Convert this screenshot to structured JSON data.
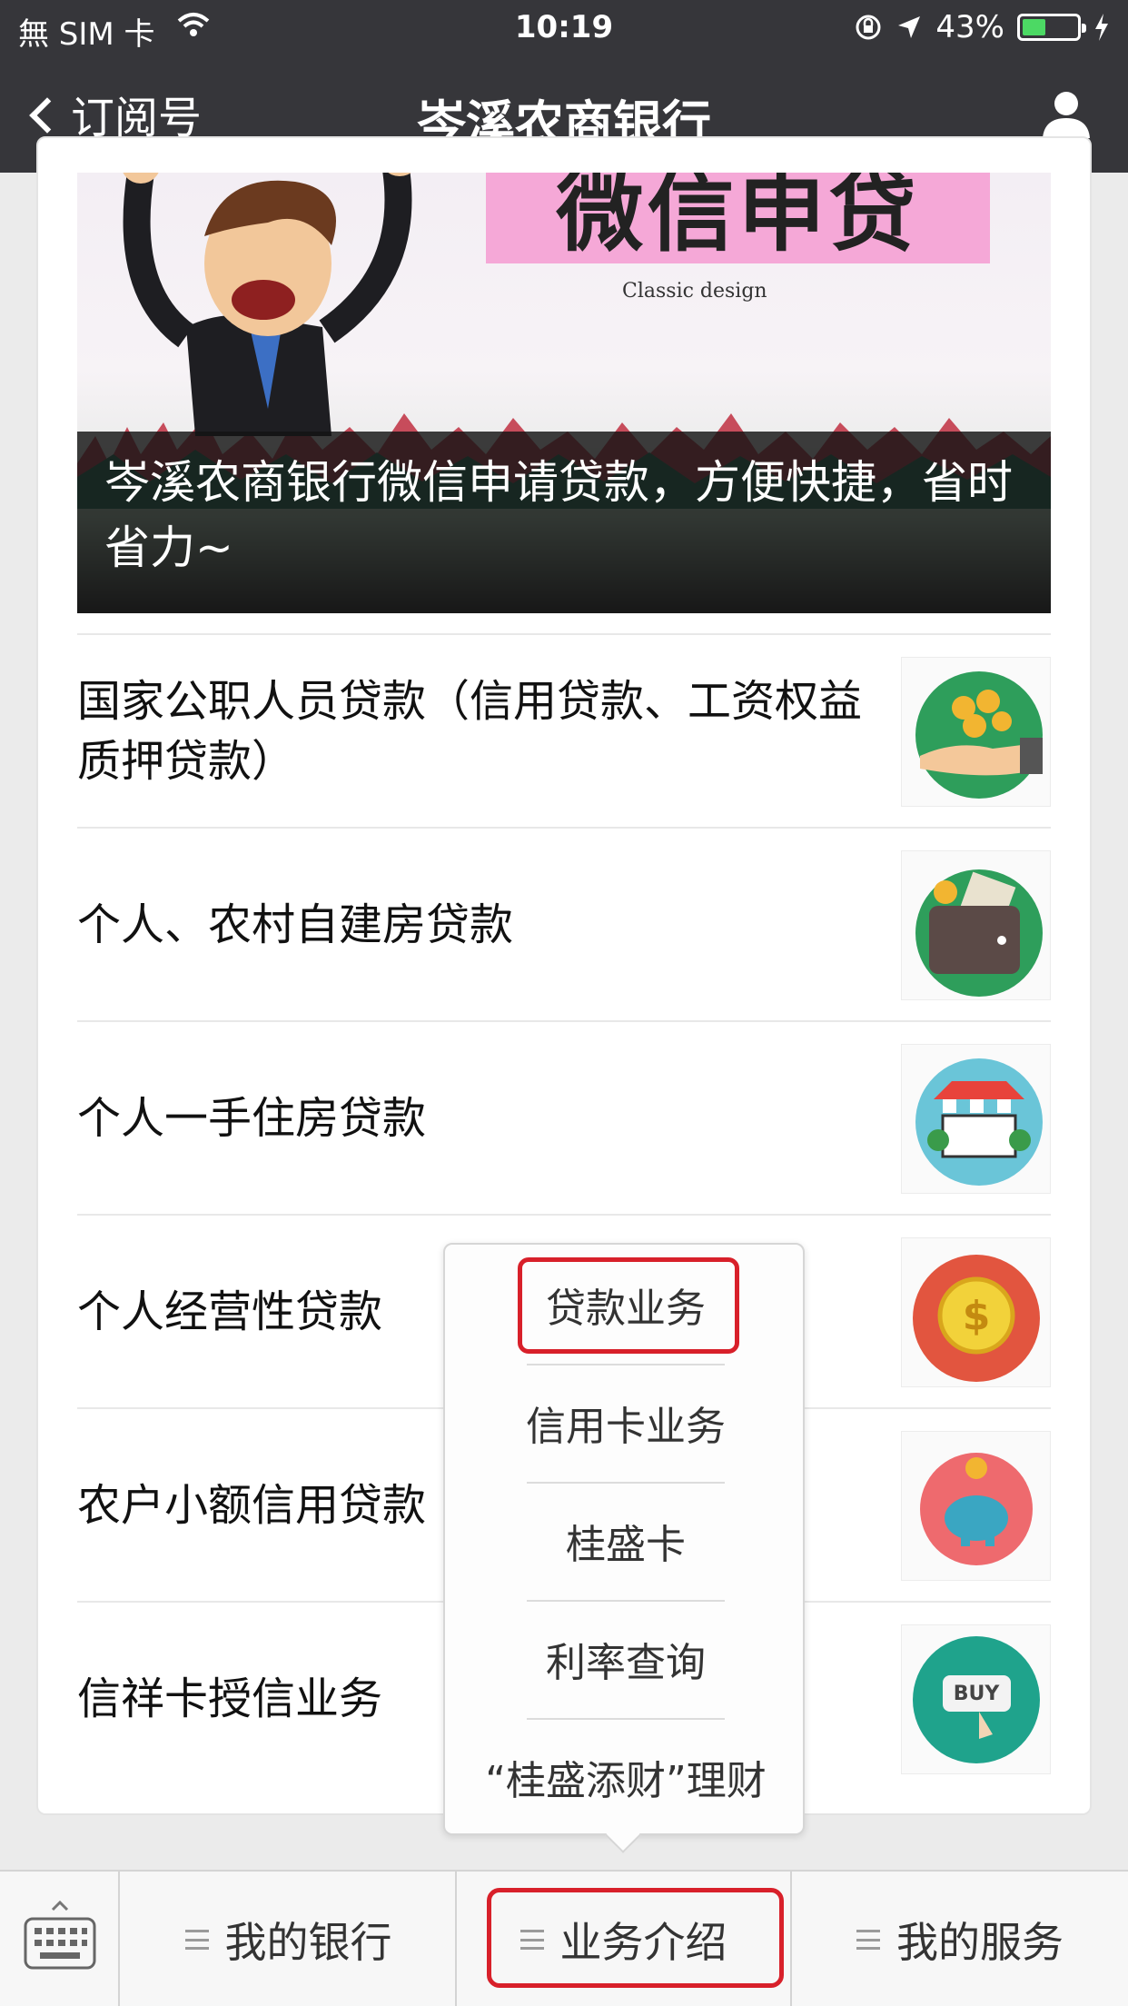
{
  "status_bar": {
    "carrier": "無 SIM 卡",
    "time": "10:19",
    "battery_percent": "43%",
    "battery_level": 0.43
  },
  "nav": {
    "back_label": "订阅号",
    "title": "岑溪农商银行"
  },
  "banner": {
    "headline": "微信申贷",
    "design_text": "Classic design",
    "caption": "岑溪农商银行微信申请贷款，方便快捷，省时省力~"
  },
  "list_items": [
    {
      "title": "国家公职人员贷款（信用贷款、工资权益质押贷款）",
      "icon": "coins-hand-icon"
    },
    {
      "title": "个人、农村自建房贷款",
      "icon": "wallet-icon"
    },
    {
      "title": "个人一手住房贷款",
      "icon": "storefront-icon"
    },
    {
      "title": "个人经营性贷款",
      "icon": "dollar-coin-icon"
    },
    {
      "title": "农户小额信用贷款",
      "icon": "piggy-bank-icon"
    },
    {
      "title": "信祥卡授信业务",
      "icon": "buy-button-icon"
    }
  ],
  "popup_menu": {
    "items": [
      "贷款业务",
      "信用卡业务",
      "桂盛卡",
      "利率查询",
      "“桂盛添财”理财"
    ]
  },
  "bottom_menu": {
    "tabs": [
      "我的银行",
      "业务介绍",
      "我的服务"
    ]
  },
  "colors": {
    "nav_bg": "#36363a",
    "highlight_red": "#d8202a",
    "battery_green": "#4cd964"
  }
}
